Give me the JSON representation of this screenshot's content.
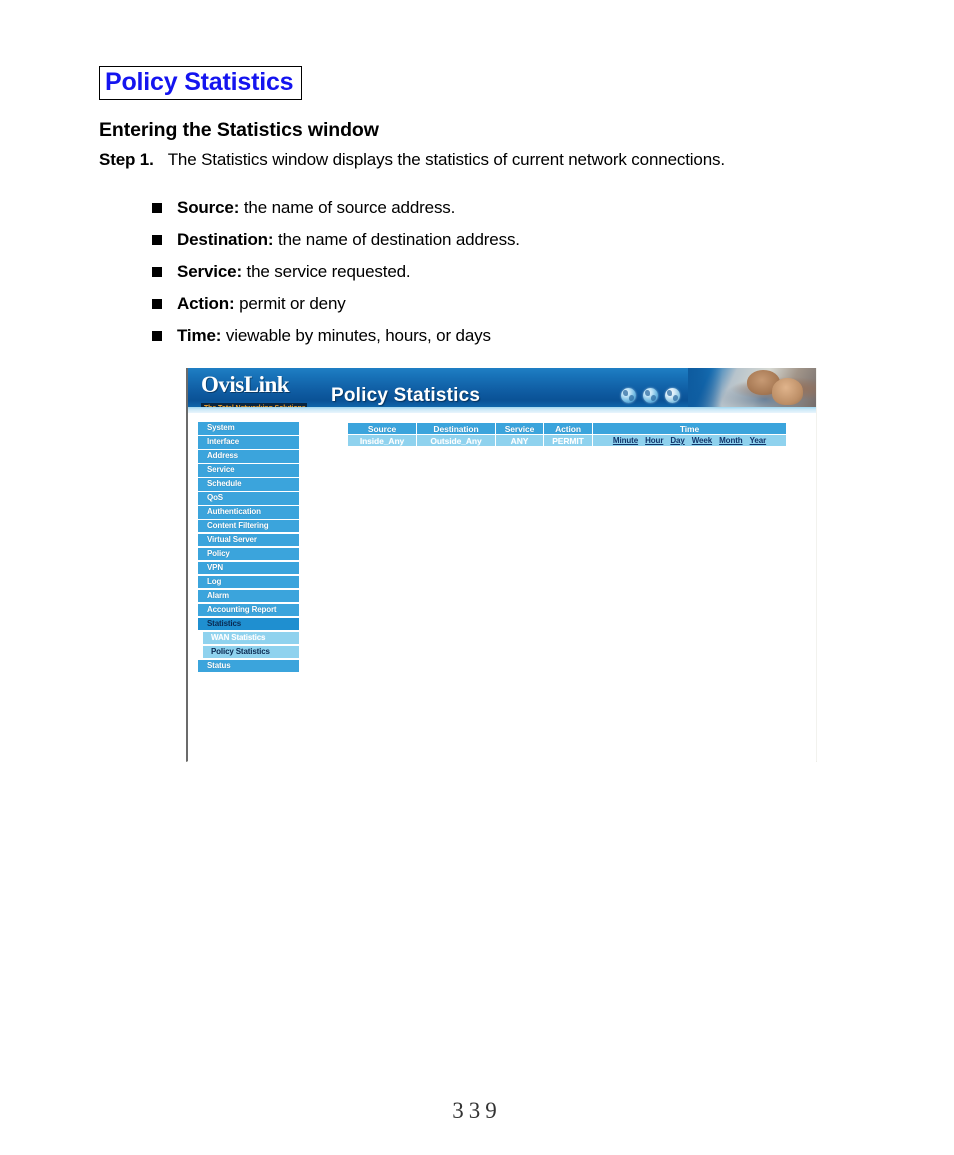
{
  "document": {
    "title": "Policy Statistics",
    "section_heading": "Entering the Statistics window",
    "step_label": "Step 1.",
    "step_text": "The Statistics window displays the statistics of current network connections.",
    "bullets": [
      {
        "term": "Source:",
        "desc": "the name of source address."
      },
      {
        "term": "Destination:",
        "desc": "the name of destination address."
      },
      {
        "term": "Service:",
        "desc": "the service requested."
      },
      {
        "term": "Action:",
        "desc": "permit or deny"
      },
      {
        "term": "Time:",
        "desc": "viewable by minutes, hours, or days"
      }
    ],
    "page_number": "339",
    "colors": {
      "title_blue": "#1414ef",
      "title_border": "#000000"
    }
  },
  "screenshot": {
    "banner": {
      "logo_word": "OvisLink",
      "logo_tagline": "The Total Networking Solutions",
      "title": "Policy Statistics",
      "icons": [
        "globe-icon",
        "globe-icon",
        "globe-icon"
      ],
      "photo_alt": "man-and-child-at-computer-photo",
      "colors": {
        "gradient_top": "#1f7fc4",
        "gradient_mid": "#0a5296",
        "strip": "#cfeaf8",
        "tagline_bg": "#09253f",
        "tagline_text": "#f3a32a"
      }
    },
    "sidebar": {
      "items": [
        {
          "label": "System",
          "state": "normal"
        },
        {
          "label": "Interface",
          "state": "normal"
        },
        {
          "label": "Address",
          "state": "normal"
        },
        {
          "label": "Service",
          "state": "normal"
        },
        {
          "label": "Schedule",
          "state": "normal"
        },
        {
          "label": "QoS",
          "state": "normal"
        },
        {
          "label": "Authentication",
          "state": "normal"
        },
        {
          "label": "Content Filtering",
          "state": "normal"
        },
        {
          "label": "Virtual Server",
          "state": "normal"
        },
        {
          "label": "Policy",
          "state": "normal"
        },
        {
          "label": "VPN",
          "state": "normal"
        },
        {
          "label": "Log",
          "state": "normal"
        },
        {
          "label": "Alarm",
          "state": "normal"
        },
        {
          "label": "Accounting Report",
          "state": "normal"
        },
        {
          "label": "Statistics",
          "state": "active"
        },
        {
          "label": "WAN Statistics",
          "state": "sub"
        },
        {
          "label": "Policy Statistics",
          "state": "sub-current"
        },
        {
          "label": "Status",
          "state": "normal"
        }
      ],
      "colors": {
        "item_bg": "#3ba4dc",
        "active_bg": "#1f8fd0",
        "sub_bg": "#8fd2ee",
        "text": "#ffffff",
        "active_text": "#0a2a52"
      }
    },
    "table": {
      "headers": [
        "Source",
        "Destination",
        "Service",
        "Action",
        "Time"
      ],
      "rows": [
        {
          "source": "Inside_Any",
          "destination": "Outside_Any",
          "service": "ANY",
          "action": "PERMIT",
          "time_links": [
            "Minute",
            "Hour",
            "Day",
            "Week",
            "Month",
            "Year"
          ]
        }
      ],
      "colors": {
        "header_bg": "#3ba4dc",
        "row_bg": "#8fd2ee",
        "link_text": "#11356b"
      }
    }
  }
}
